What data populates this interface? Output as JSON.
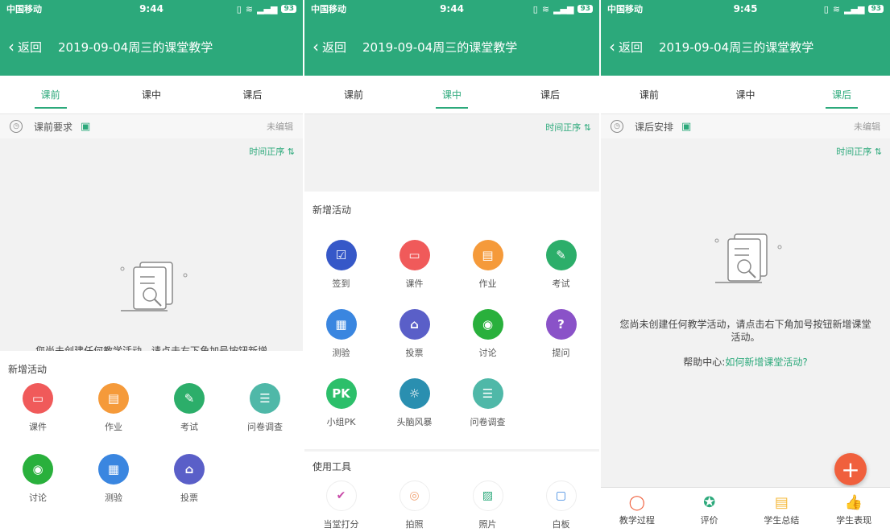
{
  "status": {
    "carrier": "中国移动",
    "battery": "93"
  },
  "nav": {
    "back": "返回",
    "title": "2019-09-04周三的课堂教学"
  },
  "tabs": [
    "课前",
    "课中",
    "课后"
  ],
  "screen1": {
    "time": "9:44",
    "req_label": "课前要求",
    "req_status": "未编辑",
    "sort": "时间正序",
    "empty_text": "您尚未创建任何教学活动，请点击右下角加号按钮新增",
    "sheet_title": "新增活动",
    "activities": [
      {
        "label": "课件",
        "color": "#f05a5a",
        "icon": "▭"
      },
      {
        "label": "作业",
        "color": "#f59a3a",
        "icon": "▤"
      },
      {
        "label": "考试",
        "color": "#2cae6a",
        "icon": "✎"
      },
      {
        "label": "问卷调查",
        "color": "#4fb8a8",
        "icon": "☰"
      },
      {
        "label": "讨论",
        "color": "#29b03c",
        "icon": "◉"
      },
      {
        "label": "测验",
        "color": "#3a86e0",
        "icon": "▦"
      },
      {
        "label": "投票",
        "color": "#5a5fc8",
        "icon": "⌂"
      }
    ]
  },
  "screen2": {
    "time": "9:44",
    "sort": "时间正序",
    "sheet_title": "新增活动",
    "activities": [
      {
        "label": "签到",
        "color": "#3658c8",
        "icon": "☑"
      },
      {
        "label": "课件",
        "color": "#f05a5a",
        "icon": "▭"
      },
      {
        "label": "作业",
        "color": "#f59a3a",
        "icon": "▤"
      },
      {
        "label": "考试",
        "color": "#2cae6a",
        "icon": "✎"
      },
      {
        "label": "测验",
        "color": "#3a86e0",
        "icon": "▦"
      },
      {
        "label": "投票",
        "color": "#5a5fc8",
        "icon": "⌂"
      },
      {
        "label": "讨论",
        "color": "#29b03c",
        "icon": "◉"
      },
      {
        "label": "提问",
        "color": "#8a52c8",
        "icon": "?"
      },
      {
        "label": "小组PK",
        "color": "#2cbf6a",
        "icon": "PK"
      },
      {
        "label": "头脑风暴",
        "color": "#2a8fb0",
        "icon": "☼"
      },
      {
        "label": "问卷调查",
        "color": "#4fb8a8",
        "icon": "☰"
      }
    ],
    "tools_title": "使用工具",
    "tools": [
      {
        "label": "当堂打分",
        "icon": "✔",
        "color": "#c84aa8"
      },
      {
        "label": "拍照",
        "icon": "◎",
        "color": "#f0a070"
      },
      {
        "label": "照片",
        "icon": "▨",
        "color": "#2ca97b"
      },
      {
        "label": "白板",
        "icon": "▢",
        "color": "#3a86e0"
      }
    ]
  },
  "screen3": {
    "time": "9:45",
    "req_label": "课后安排",
    "req_status": "未编辑",
    "sort": "时间正序",
    "empty_text": "您尚未创建任何教学活动，请点击右下角加号按钮新增课堂活动。",
    "help_prefix": "帮助中心:",
    "help_link": "如何新增课堂活动?",
    "fab": "+",
    "bottom_nav": [
      {
        "label": "教学过程",
        "icon": "◯",
        "color": "#f0603d"
      },
      {
        "label": "评价",
        "icon": "✪",
        "color": "#2ca97b"
      },
      {
        "label": "学生总结",
        "icon": "▤",
        "color": "#f5b83a"
      },
      {
        "label": "学生表现",
        "icon": "👍",
        "color": "#c84aa8"
      }
    ]
  }
}
